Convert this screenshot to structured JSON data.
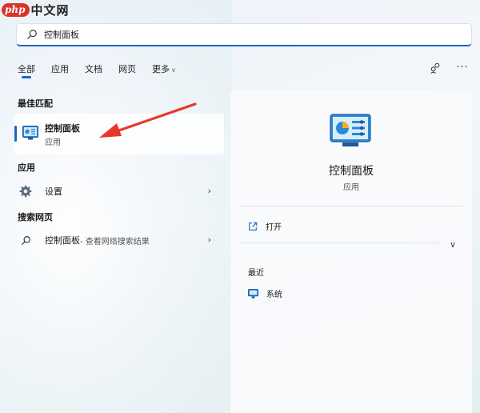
{
  "watermark": {
    "php": "php",
    "site": "中文网"
  },
  "search": {
    "value": "控制面板",
    "placeholder": ""
  },
  "tabs": [
    {
      "label": "全部",
      "active": true
    },
    {
      "label": "应用"
    },
    {
      "label": "文档"
    },
    {
      "label": "网页"
    },
    {
      "label": "更多"
    }
  ],
  "top_right_icons": [
    "account-switch-icon",
    "more-icon"
  ],
  "sections": {
    "best_match": "最佳匹配",
    "apps": "应用",
    "web": "搜索网页"
  },
  "best_match": {
    "title": "控制面板",
    "subtitle": "应用"
  },
  "apps": [
    {
      "label": "设置",
      "icon": "gear-icon"
    }
  ],
  "web": [
    {
      "label": "控制面板",
      "hint": " - 查看网络搜索结果"
    }
  ],
  "detail": {
    "title": "控制面板",
    "subtitle": "应用",
    "open_label": "打开",
    "recent_label": "最近",
    "recent_items": [
      {
        "label": "系统",
        "icon": "system-icon"
      }
    ]
  },
  "colors": {
    "accent": "#1a66c5",
    "annotation": "#e8372c"
  }
}
